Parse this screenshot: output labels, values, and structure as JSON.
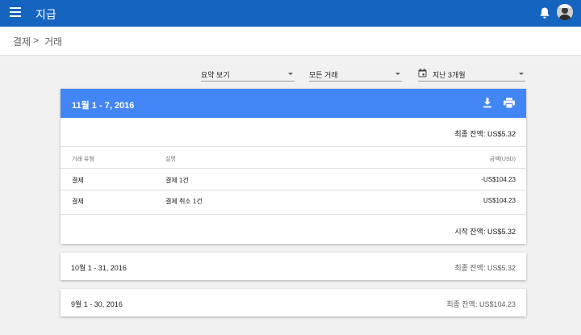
{
  "appbar": {
    "title": "지급",
    "menu_icon": "menu-icon",
    "notification_icon": "bell-icon",
    "avatar": "avatar"
  },
  "breadcrumb": {
    "parent": "결제",
    "separator": ">",
    "current": "거래"
  },
  "filters": {
    "view": "요약 보기",
    "transactions": "모든 거래",
    "period": "지난 3개월"
  },
  "main_card": {
    "range": "11월 1 - 7, 2016",
    "ending_balance": "최종 잔액: US$5.32",
    "columns": [
      "거래 유형",
      "설명",
      "금액(USD)"
    ],
    "rows": [
      {
        "type": "결제",
        "description": "결제 1건",
        "amount": "-US$104.23"
      },
      {
        "type": "결제",
        "description": "결제 취소 1건",
        "amount": "US$104.23"
      }
    ],
    "starting_balance": "시작 잔액: US$5.32"
  },
  "other_periods": [
    {
      "range": "10월 1 - 31, 2016",
      "balance": "최종 잔액: US$5.32"
    },
    {
      "range": "9월 1 - 30, 2016",
      "balance": "최종 잔액: US$104.23"
    }
  ],
  "colors": {
    "appbar": "#1565c0",
    "card_header": "#4285f4",
    "background": "#f1f1f1"
  }
}
